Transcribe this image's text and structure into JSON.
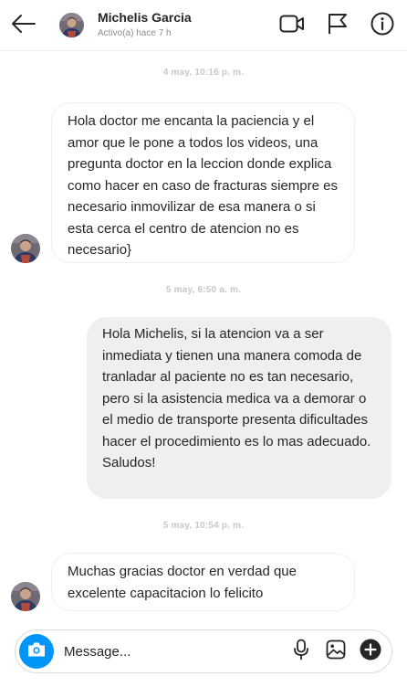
{
  "header": {
    "contact_name": "Michelis Garcia",
    "status": "Activo(a) hace 7 h"
  },
  "thread": [
    {
      "type": "timestamp",
      "text": "4 may, 10:16 p. m."
    },
    {
      "type": "message",
      "direction": "incoming",
      "text": " Hola doctor me encanta la paciencia y el amor que le pone a todos los videos, una pregunta doctor en la leccion donde explica como hacer en caso de fracturas siempre es necesario inmovilizar de esa manera o si esta cerca el centro de atencion no es necesario}"
    },
    {
      "type": "timestamp",
      "text": "5 may, 6:50 a. m."
    },
    {
      "type": "message",
      "direction": "outgoing",
      "text": "Hola Michelis, si la atencion va a ser inmediata y tienen una manera comoda de tranladar al paciente no es tan necesario, pero si la asistencia medica va a demorar o el medio de transporte presenta dificultades hacer el procedimiento es lo mas adecuado. Saludos!"
    },
    {
      "type": "timestamp",
      "text": "5 may, 10:54 p. m."
    },
    {
      "type": "message",
      "direction": "incoming",
      "text": "Muchas gracias doctor en verdad que excelente capacitacion lo felicito"
    }
  ],
  "composer": {
    "placeholder": "Message...",
    "value": ""
  },
  "icons": {
    "back": "arrow-left-icon",
    "video": "video-camera-icon",
    "flag": "flag-icon",
    "info": "info-icon",
    "camera": "camera-icon",
    "mic": "microphone-icon",
    "image": "image-icon",
    "add": "plus-circle-icon"
  },
  "colors": {
    "accent": "#0095f6",
    "outgoing_bubble": "#efefef",
    "text": "#262626",
    "muted": "#8e8e8e"
  }
}
